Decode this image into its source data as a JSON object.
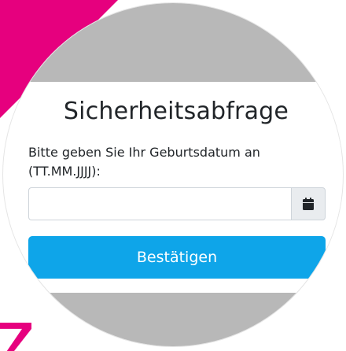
{
  "form": {
    "title": "Sicherheitsabfrage",
    "label": "Bitte geben Sie Ihr Geburtsdatum an (TT.MM.JJJJ):",
    "date_value": "",
    "date_placeholder": "",
    "submit_label": "Bestätigen"
  },
  "icons": {
    "calendar": "calendar-icon"
  },
  "colors": {
    "accent": "#0ea5e9",
    "brand_pink": "#e6007e",
    "backdrop_gray": "#b8b8b8"
  }
}
